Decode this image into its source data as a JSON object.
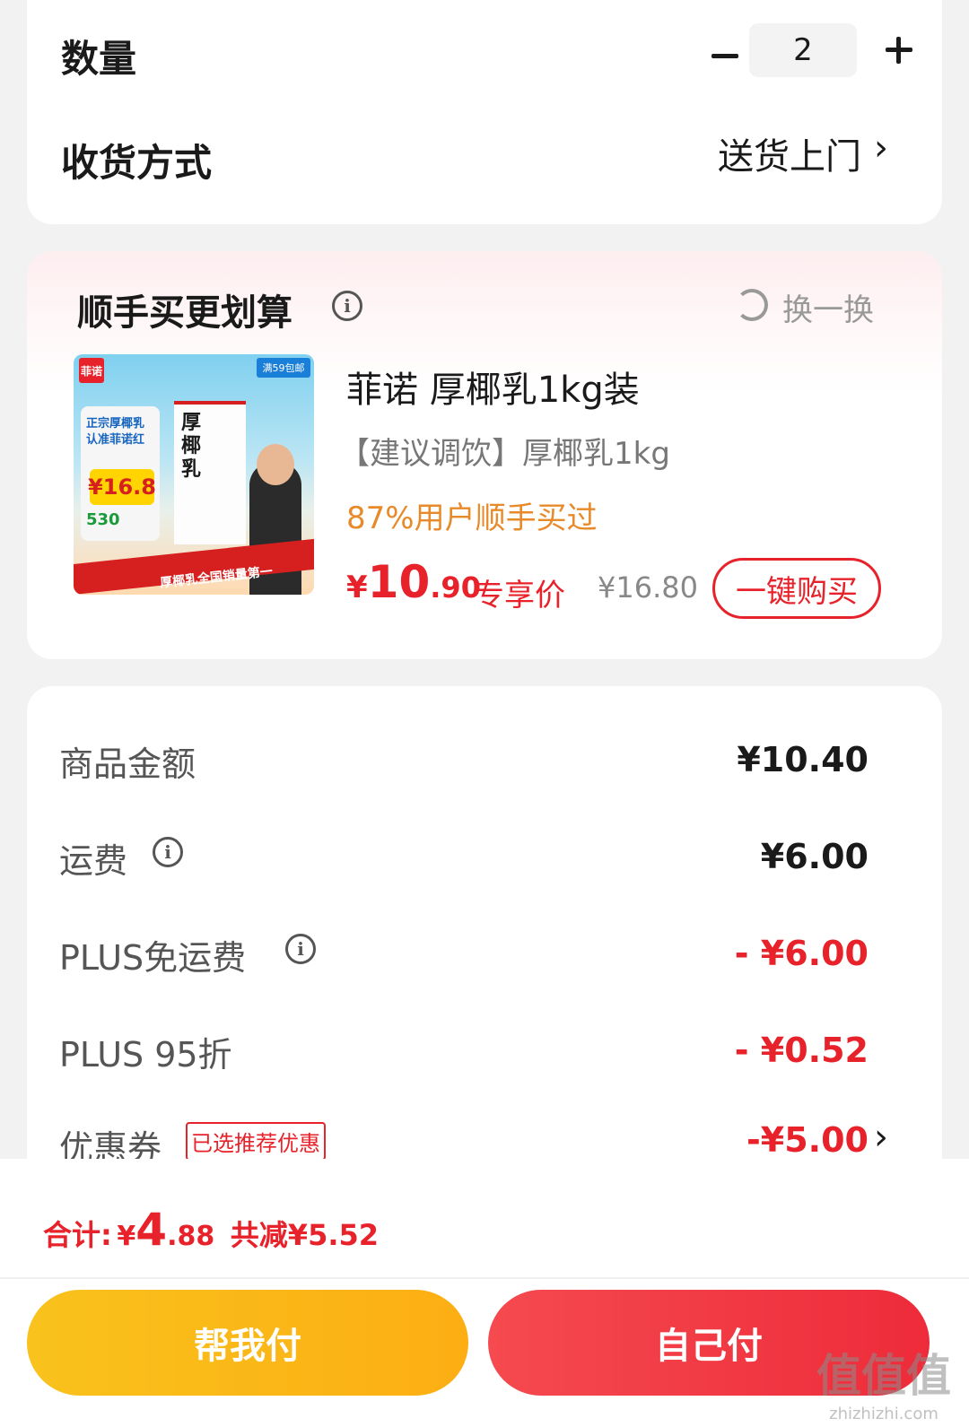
{
  "quantity": {
    "label": "数量",
    "value": "2"
  },
  "delivery": {
    "label": "收货方式",
    "value": "送货上门"
  },
  "bundle": {
    "title": "顺手买更划算",
    "refresh_label": "换一换",
    "product": {
      "image_texts": {
        "logo": "菲诺",
        "badge": "满59包邮",
        "box": "厚椰乳",
        "line1": "正宗厚椰乳",
        "line2": "认准菲诺红",
        "price": "¥16.8",
        "bonus": "530",
        "banner": "厚椰乳全国销量第一"
      },
      "name": "菲诺 厚椰乳1kg装",
      "subtitle": "【建议调饮】厚椰乳1kg",
      "social_proof": "87%用户顺手买过",
      "price_symbol": "¥",
      "price_int": "10",
      "price_dec": ".90",
      "price_tag": "专享价",
      "original_price": "¥16.80",
      "buy_label": "一键购买"
    }
  },
  "summary": {
    "rows": [
      {
        "label": "商品金额",
        "value": "¥10.40"
      },
      {
        "label": "运费",
        "value": "¥6.00"
      },
      {
        "label": "PLUS免运费",
        "value": "- ¥6.00"
      },
      {
        "label": "PLUS 95折",
        "value": "- ¥0.52"
      },
      {
        "label": "优惠券",
        "value": "-¥5.00",
        "tag": "已选推荐优惠"
      }
    ]
  },
  "footer": {
    "total_prefix": "合计:",
    "total_symbol": "¥",
    "total_int": "4",
    "total_dec": ".88",
    "saved": "共减¥5.52",
    "help_pay_label": "帮我付",
    "self_pay_label": "自己付",
    "watermark": "值值值",
    "watermark_site": "zhizhizhi.com"
  },
  "colors": {
    "accent_red": "#e8222a",
    "orange": "#e88a2a",
    "yellow_button": "#fcae13"
  }
}
